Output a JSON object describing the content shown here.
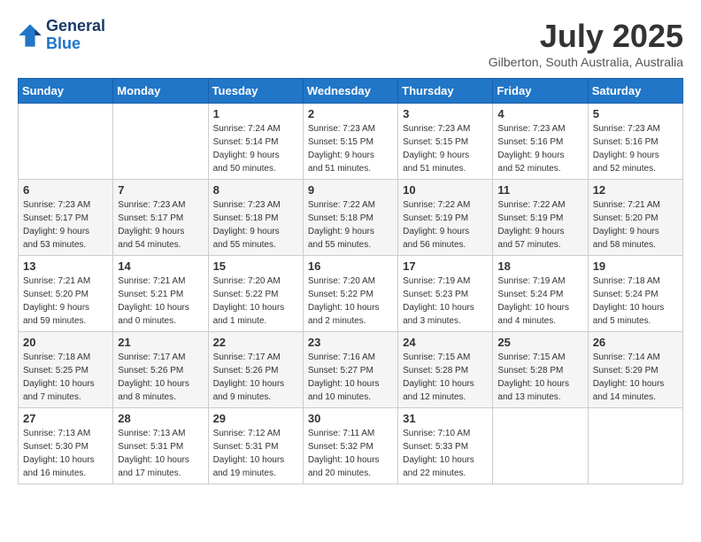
{
  "header": {
    "logo_line1": "General",
    "logo_line2": "Blue",
    "month_title": "July 2025",
    "location": "Gilberton, South Australia, Australia"
  },
  "weekdays": [
    "Sunday",
    "Monday",
    "Tuesday",
    "Wednesday",
    "Thursday",
    "Friday",
    "Saturday"
  ],
  "weeks": [
    [
      {
        "day": "",
        "info": ""
      },
      {
        "day": "",
        "info": ""
      },
      {
        "day": "1",
        "info": "Sunrise: 7:24 AM\nSunset: 5:14 PM\nDaylight: 9 hours\nand 50 minutes."
      },
      {
        "day": "2",
        "info": "Sunrise: 7:23 AM\nSunset: 5:15 PM\nDaylight: 9 hours\nand 51 minutes."
      },
      {
        "day": "3",
        "info": "Sunrise: 7:23 AM\nSunset: 5:15 PM\nDaylight: 9 hours\nand 51 minutes."
      },
      {
        "day": "4",
        "info": "Sunrise: 7:23 AM\nSunset: 5:16 PM\nDaylight: 9 hours\nand 52 minutes."
      },
      {
        "day": "5",
        "info": "Sunrise: 7:23 AM\nSunset: 5:16 PM\nDaylight: 9 hours\nand 52 minutes."
      }
    ],
    [
      {
        "day": "6",
        "info": "Sunrise: 7:23 AM\nSunset: 5:17 PM\nDaylight: 9 hours\nand 53 minutes."
      },
      {
        "day": "7",
        "info": "Sunrise: 7:23 AM\nSunset: 5:17 PM\nDaylight: 9 hours\nand 54 minutes."
      },
      {
        "day": "8",
        "info": "Sunrise: 7:23 AM\nSunset: 5:18 PM\nDaylight: 9 hours\nand 55 minutes."
      },
      {
        "day": "9",
        "info": "Sunrise: 7:22 AM\nSunset: 5:18 PM\nDaylight: 9 hours\nand 55 minutes."
      },
      {
        "day": "10",
        "info": "Sunrise: 7:22 AM\nSunset: 5:19 PM\nDaylight: 9 hours\nand 56 minutes."
      },
      {
        "day": "11",
        "info": "Sunrise: 7:22 AM\nSunset: 5:19 PM\nDaylight: 9 hours\nand 57 minutes."
      },
      {
        "day": "12",
        "info": "Sunrise: 7:21 AM\nSunset: 5:20 PM\nDaylight: 9 hours\nand 58 minutes."
      }
    ],
    [
      {
        "day": "13",
        "info": "Sunrise: 7:21 AM\nSunset: 5:20 PM\nDaylight: 9 hours\nand 59 minutes."
      },
      {
        "day": "14",
        "info": "Sunrise: 7:21 AM\nSunset: 5:21 PM\nDaylight: 10 hours\nand 0 minutes."
      },
      {
        "day": "15",
        "info": "Sunrise: 7:20 AM\nSunset: 5:22 PM\nDaylight: 10 hours\nand 1 minute."
      },
      {
        "day": "16",
        "info": "Sunrise: 7:20 AM\nSunset: 5:22 PM\nDaylight: 10 hours\nand 2 minutes."
      },
      {
        "day": "17",
        "info": "Sunrise: 7:19 AM\nSunset: 5:23 PM\nDaylight: 10 hours\nand 3 minutes."
      },
      {
        "day": "18",
        "info": "Sunrise: 7:19 AM\nSunset: 5:24 PM\nDaylight: 10 hours\nand 4 minutes."
      },
      {
        "day": "19",
        "info": "Sunrise: 7:18 AM\nSunset: 5:24 PM\nDaylight: 10 hours\nand 5 minutes."
      }
    ],
    [
      {
        "day": "20",
        "info": "Sunrise: 7:18 AM\nSunset: 5:25 PM\nDaylight: 10 hours\nand 7 minutes."
      },
      {
        "day": "21",
        "info": "Sunrise: 7:17 AM\nSunset: 5:26 PM\nDaylight: 10 hours\nand 8 minutes."
      },
      {
        "day": "22",
        "info": "Sunrise: 7:17 AM\nSunset: 5:26 PM\nDaylight: 10 hours\nand 9 minutes."
      },
      {
        "day": "23",
        "info": "Sunrise: 7:16 AM\nSunset: 5:27 PM\nDaylight: 10 hours\nand 10 minutes."
      },
      {
        "day": "24",
        "info": "Sunrise: 7:15 AM\nSunset: 5:28 PM\nDaylight: 10 hours\nand 12 minutes."
      },
      {
        "day": "25",
        "info": "Sunrise: 7:15 AM\nSunset: 5:28 PM\nDaylight: 10 hours\nand 13 minutes."
      },
      {
        "day": "26",
        "info": "Sunrise: 7:14 AM\nSunset: 5:29 PM\nDaylight: 10 hours\nand 14 minutes."
      }
    ],
    [
      {
        "day": "27",
        "info": "Sunrise: 7:13 AM\nSunset: 5:30 PM\nDaylight: 10 hours\nand 16 minutes."
      },
      {
        "day": "28",
        "info": "Sunrise: 7:13 AM\nSunset: 5:31 PM\nDaylight: 10 hours\nand 17 minutes."
      },
      {
        "day": "29",
        "info": "Sunrise: 7:12 AM\nSunset: 5:31 PM\nDaylight: 10 hours\nand 19 minutes."
      },
      {
        "day": "30",
        "info": "Sunrise: 7:11 AM\nSunset: 5:32 PM\nDaylight: 10 hours\nand 20 minutes."
      },
      {
        "day": "31",
        "info": "Sunrise: 7:10 AM\nSunset: 5:33 PM\nDaylight: 10 hours\nand 22 minutes."
      },
      {
        "day": "",
        "info": ""
      },
      {
        "day": "",
        "info": ""
      }
    ]
  ]
}
